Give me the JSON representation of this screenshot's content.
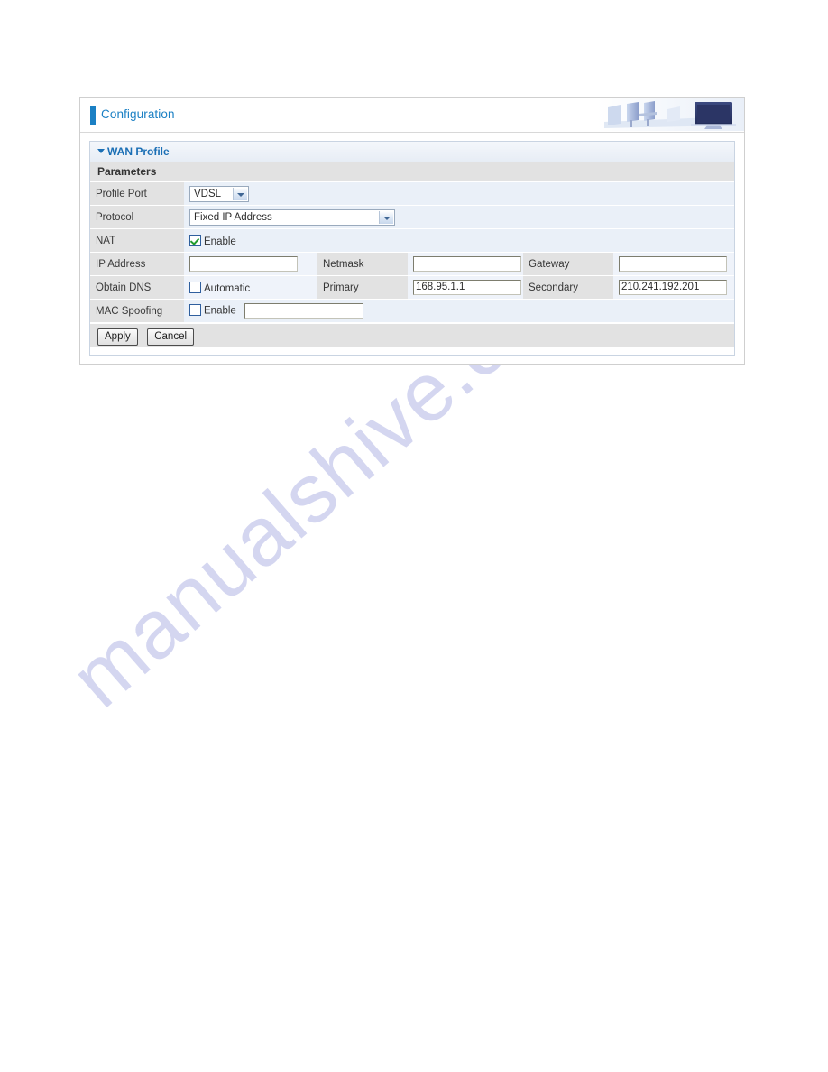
{
  "watermark": {
    "text": "manualshive.com"
  },
  "header": {
    "title": "Configuration",
    "art_icon": "office-desks-monitor-image"
  },
  "panel": {
    "title": "WAN Profile",
    "collapse_icon": "triangle-down-icon",
    "section_header": "Parameters"
  },
  "form": {
    "profile_port": {
      "label": "Profile Port",
      "value": "VDSL",
      "options": [
        "VDSL"
      ],
      "dropdown_icon": "chevron-down-icon"
    },
    "protocol": {
      "label": "Protocol",
      "value": "Fixed IP Address",
      "options": [
        "Fixed IP Address"
      ],
      "dropdown_icon": "chevron-down-icon"
    },
    "nat": {
      "label": "NAT",
      "checkbox_label": "Enable",
      "checked": true
    },
    "ip_address": {
      "label": "IP Address",
      "value": "",
      "netmask_label": "Netmask",
      "netmask_value": "",
      "gateway_label": "Gateway",
      "gateway_value": ""
    },
    "obtain_dns": {
      "label": "Obtain DNS",
      "automatic_label": "Automatic",
      "automatic_checked": false,
      "primary_label": "Primary",
      "primary_value": "168.95.1.1",
      "secondary_label": "Secondary",
      "secondary_value": "210.241.192.201"
    },
    "mac_spoofing": {
      "label": "MAC Spoofing",
      "checkbox_label": "Enable",
      "checked": false,
      "value": ""
    }
  },
  "buttons": {
    "apply": "Apply",
    "cancel": "Cancel"
  },
  "colors": {
    "accent_blue": "#1b80c4",
    "panel_title_blue": "#1b6fb5",
    "label_gray": "#e2e2e2",
    "field_blue": "#eaf0f8",
    "checkmark_green": "#1f9b2e",
    "watermark_purple": "#9aa0dd"
  }
}
